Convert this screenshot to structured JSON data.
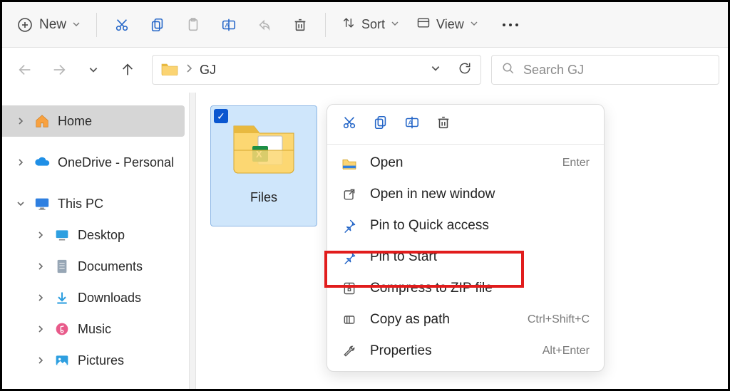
{
  "toolbar": {
    "new_label": "New",
    "sort_label": "Sort",
    "view_label": "View"
  },
  "breadcrumb": {
    "current": "GJ"
  },
  "search": {
    "placeholder": "Search GJ"
  },
  "sidebar": {
    "home": "Home",
    "onedrive": "OneDrive - Personal",
    "thispc": "This PC",
    "desktop": "Desktop",
    "documents": "Documents",
    "downloads": "Downloads",
    "music": "Music",
    "pictures": "Pictures"
  },
  "file": {
    "name": "Files"
  },
  "context_menu": {
    "open": "Open",
    "open_sc": "Enter",
    "open_new": "Open in new window",
    "pin_quick": "Pin to Quick access",
    "pin_start": "Pin to Start",
    "compress": "Compress to ZIP file",
    "copy_path": "Copy as path",
    "copy_path_sc": "Ctrl+Shift+C",
    "properties": "Properties",
    "properties_sc": "Alt+Enter"
  }
}
